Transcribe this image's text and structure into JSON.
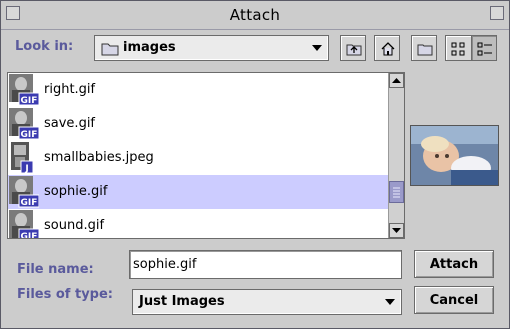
{
  "window": {
    "title": "Attach"
  },
  "look_in": {
    "label": "Look in:",
    "folder": "images",
    "toolbar": {
      "up_icon": "up-folder-icon",
      "home_icon": "home-icon",
      "new_folder_icon": "new-folder-icon",
      "list_view_icon": "list-view-icon",
      "details_view_icon": "details-view-icon"
    }
  },
  "files": [
    {
      "name": "right.gif",
      "icon": "gif-file-icon",
      "badge": "GIF",
      "selected": false
    },
    {
      "name": "save.gif",
      "icon": "gif-file-icon",
      "badge": "GIF",
      "selected": false
    },
    {
      "name": "smallbabies.jpeg",
      "icon": "jpeg-file-icon",
      "badge": "J",
      "selected": false
    },
    {
      "name": "sophie.gif",
      "icon": "gif-file-icon",
      "badge": "GIF",
      "selected": true
    },
    {
      "name": "sound.gif",
      "icon": "gif-file-icon",
      "badge": "GIF",
      "selected": false
    }
  ],
  "file_name": {
    "label": "File name:",
    "value": "sophie.gif"
  },
  "file_type": {
    "label": "Files of type:",
    "value": "Just Images"
  },
  "buttons": {
    "attach": "Attach",
    "cancel": "Cancel"
  },
  "colors": {
    "accent_label": "#5a5a9c",
    "selection": "#ccccff",
    "thumb": "#9a9aca"
  }
}
